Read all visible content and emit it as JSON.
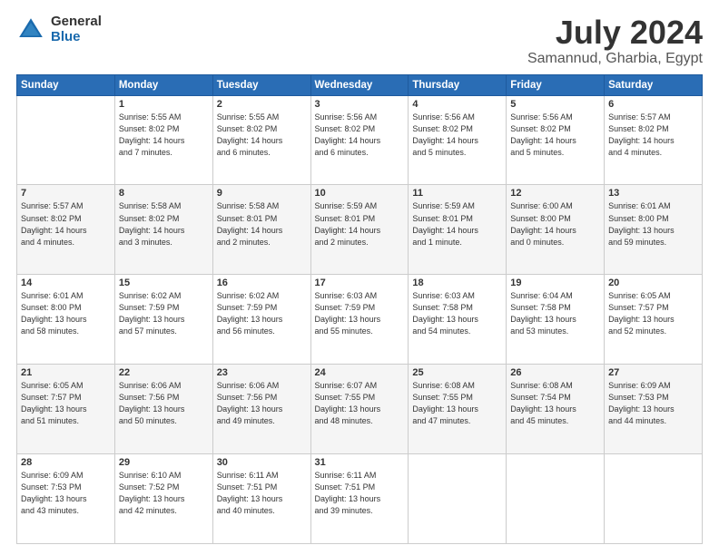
{
  "logo": {
    "general": "General",
    "blue": "Blue"
  },
  "title": {
    "month_year": "July 2024",
    "location": "Samannud, Gharbia, Egypt"
  },
  "days_of_week": [
    "Sunday",
    "Monday",
    "Tuesday",
    "Wednesday",
    "Thursday",
    "Friday",
    "Saturday"
  ],
  "weeks": [
    [
      {
        "day": "",
        "info": ""
      },
      {
        "day": "1",
        "info": "Sunrise: 5:55 AM\nSunset: 8:02 PM\nDaylight: 14 hours\nand 7 minutes."
      },
      {
        "day": "2",
        "info": "Sunrise: 5:55 AM\nSunset: 8:02 PM\nDaylight: 14 hours\nand 6 minutes."
      },
      {
        "day": "3",
        "info": "Sunrise: 5:56 AM\nSunset: 8:02 PM\nDaylight: 14 hours\nand 6 minutes."
      },
      {
        "day": "4",
        "info": "Sunrise: 5:56 AM\nSunset: 8:02 PM\nDaylight: 14 hours\nand 5 minutes."
      },
      {
        "day": "5",
        "info": "Sunrise: 5:56 AM\nSunset: 8:02 PM\nDaylight: 14 hours\nand 5 minutes."
      },
      {
        "day": "6",
        "info": "Sunrise: 5:57 AM\nSunset: 8:02 PM\nDaylight: 14 hours\nand 4 minutes."
      }
    ],
    [
      {
        "day": "7",
        "info": "Sunrise: 5:57 AM\nSunset: 8:02 PM\nDaylight: 14 hours\nand 4 minutes."
      },
      {
        "day": "8",
        "info": "Sunrise: 5:58 AM\nSunset: 8:02 PM\nDaylight: 14 hours\nand 3 minutes."
      },
      {
        "day": "9",
        "info": "Sunrise: 5:58 AM\nSunset: 8:01 PM\nDaylight: 14 hours\nand 2 minutes."
      },
      {
        "day": "10",
        "info": "Sunrise: 5:59 AM\nSunset: 8:01 PM\nDaylight: 14 hours\nand 2 minutes."
      },
      {
        "day": "11",
        "info": "Sunrise: 5:59 AM\nSunset: 8:01 PM\nDaylight: 14 hours\nand 1 minute."
      },
      {
        "day": "12",
        "info": "Sunrise: 6:00 AM\nSunset: 8:00 PM\nDaylight: 14 hours\nand 0 minutes."
      },
      {
        "day": "13",
        "info": "Sunrise: 6:01 AM\nSunset: 8:00 PM\nDaylight: 13 hours\nand 59 minutes."
      }
    ],
    [
      {
        "day": "14",
        "info": "Sunrise: 6:01 AM\nSunset: 8:00 PM\nDaylight: 13 hours\nand 58 minutes."
      },
      {
        "day": "15",
        "info": "Sunrise: 6:02 AM\nSunset: 7:59 PM\nDaylight: 13 hours\nand 57 minutes."
      },
      {
        "day": "16",
        "info": "Sunrise: 6:02 AM\nSunset: 7:59 PM\nDaylight: 13 hours\nand 56 minutes."
      },
      {
        "day": "17",
        "info": "Sunrise: 6:03 AM\nSunset: 7:59 PM\nDaylight: 13 hours\nand 55 minutes."
      },
      {
        "day": "18",
        "info": "Sunrise: 6:03 AM\nSunset: 7:58 PM\nDaylight: 13 hours\nand 54 minutes."
      },
      {
        "day": "19",
        "info": "Sunrise: 6:04 AM\nSunset: 7:58 PM\nDaylight: 13 hours\nand 53 minutes."
      },
      {
        "day": "20",
        "info": "Sunrise: 6:05 AM\nSunset: 7:57 PM\nDaylight: 13 hours\nand 52 minutes."
      }
    ],
    [
      {
        "day": "21",
        "info": "Sunrise: 6:05 AM\nSunset: 7:57 PM\nDaylight: 13 hours\nand 51 minutes."
      },
      {
        "day": "22",
        "info": "Sunrise: 6:06 AM\nSunset: 7:56 PM\nDaylight: 13 hours\nand 50 minutes."
      },
      {
        "day": "23",
        "info": "Sunrise: 6:06 AM\nSunset: 7:56 PM\nDaylight: 13 hours\nand 49 minutes."
      },
      {
        "day": "24",
        "info": "Sunrise: 6:07 AM\nSunset: 7:55 PM\nDaylight: 13 hours\nand 48 minutes."
      },
      {
        "day": "25",
        "info": "Sunrise: 6:08 AM\nSunset: 7:55 PM\nDaylight: 13 hours\nand 47 minutes."
      },
      {
        "day": "26",
        "info": "Sunrise: 6:08 AM\nSunset: 7:54 PM\nDaylight: 13 hours\nand 45 minutes."
      },
      {
        "day": "27",
        "info": "Sunrise: 6:09 AM\nSunset: 7:53 PM\nDaylight: 13 hours\nand 44 minutes."
      }
    ],
    [
      {
        "day": "28",
        "info": "Sunrise: 6:09 AM\nSunset: 7:53 PM\nDaylight: 13 hours\nand 43 minutes."
      },
      {
        "day": "29",
        "info": "Sunrise: 6:10 AM\nSunset: 7:52 PM\nDaylight: 13 hours\nand 42 minutes."
      },
      {
        "day": "30",
        "info": "Sunrise: 6:11 AM\nSunset: 7:51 PM\nDaylight: 13 hours\nand 40 minutes."
      },
      {
        "day": "31",
        "info": "Sunrise: 6:11 AM\nSunset: 7:51 PM\nDaylight: 13 hours\nand 39 minutes."
      },
      {
        "day": "",
        "info": ""
      },
      {
        "day": "",
        "info": ""
      },
      {
        "day": "",
        "info": ""
      }
    ]
  ]
}
